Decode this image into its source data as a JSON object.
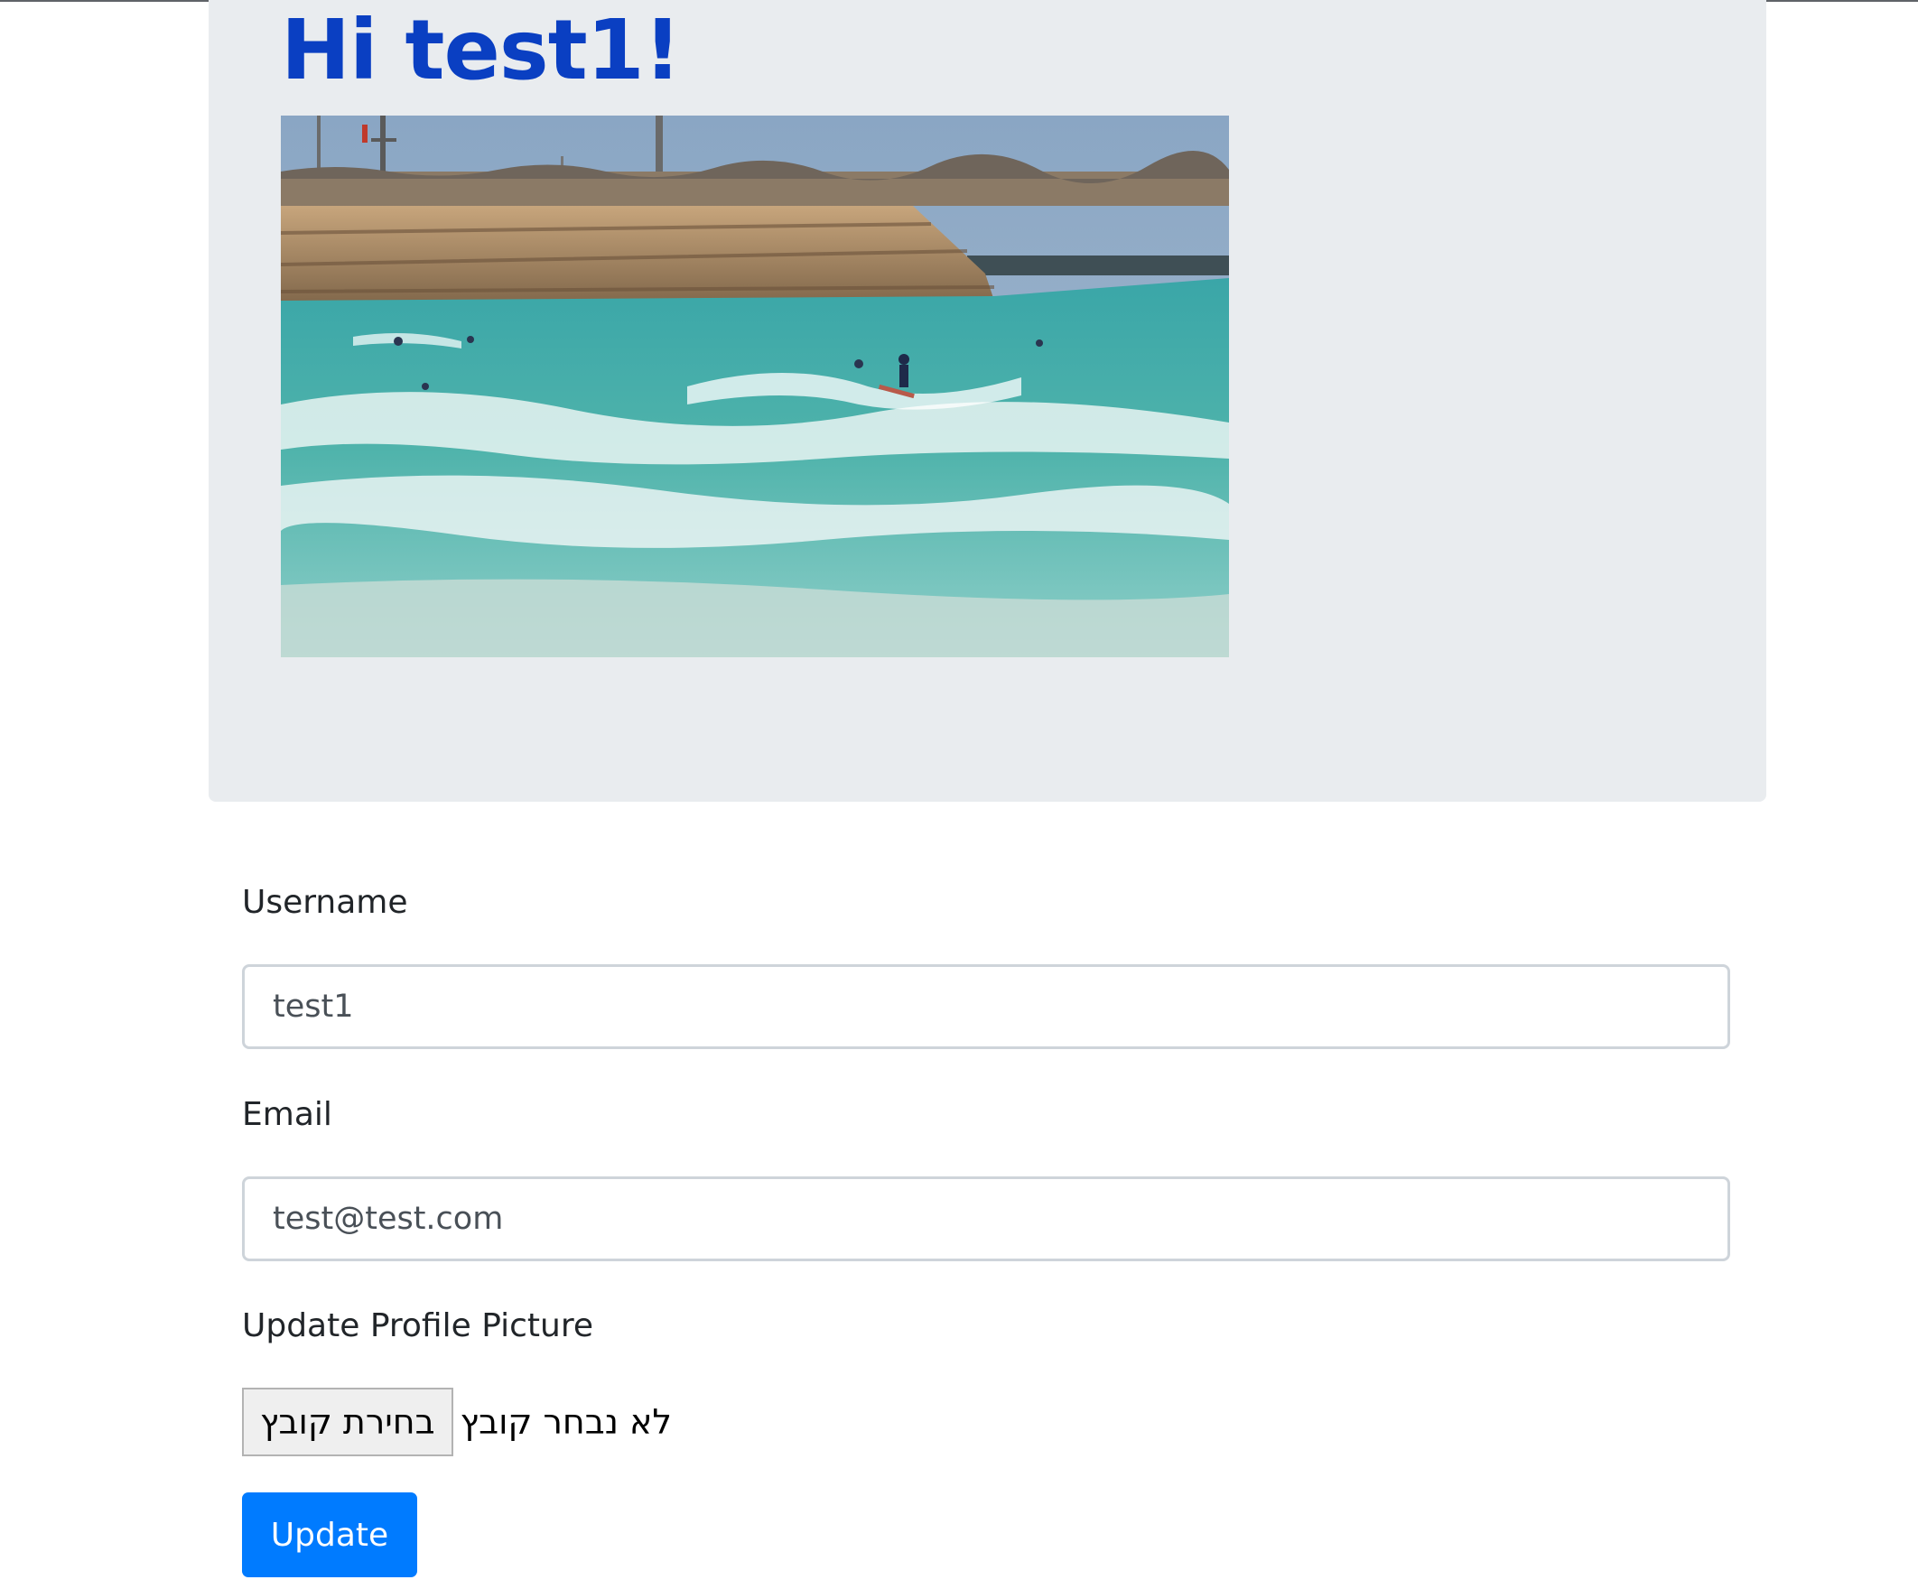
{
  "header": {
    "greeting": "Hi test1!"
  },
  "profile": {
    "image_description": "beach with surfers and breakwater"
  },
  "form": {
    "username_label": "Username",
    "username_value": "test1",
    "email_label": "Email",
    "email_value": "test@test.com",
    "picture_label": "Update Profile Picture",
    "file_button_label": "בחירת קובץ",
    "file_status": "לא נבחר קובץ",
    "submit_label": "Update"
  },
  "colors": {
    "title": "#0a3fc2",
    "jumbotron_bg": "#e9ecef",
    "primary_button": "#007bff"
  }
}
